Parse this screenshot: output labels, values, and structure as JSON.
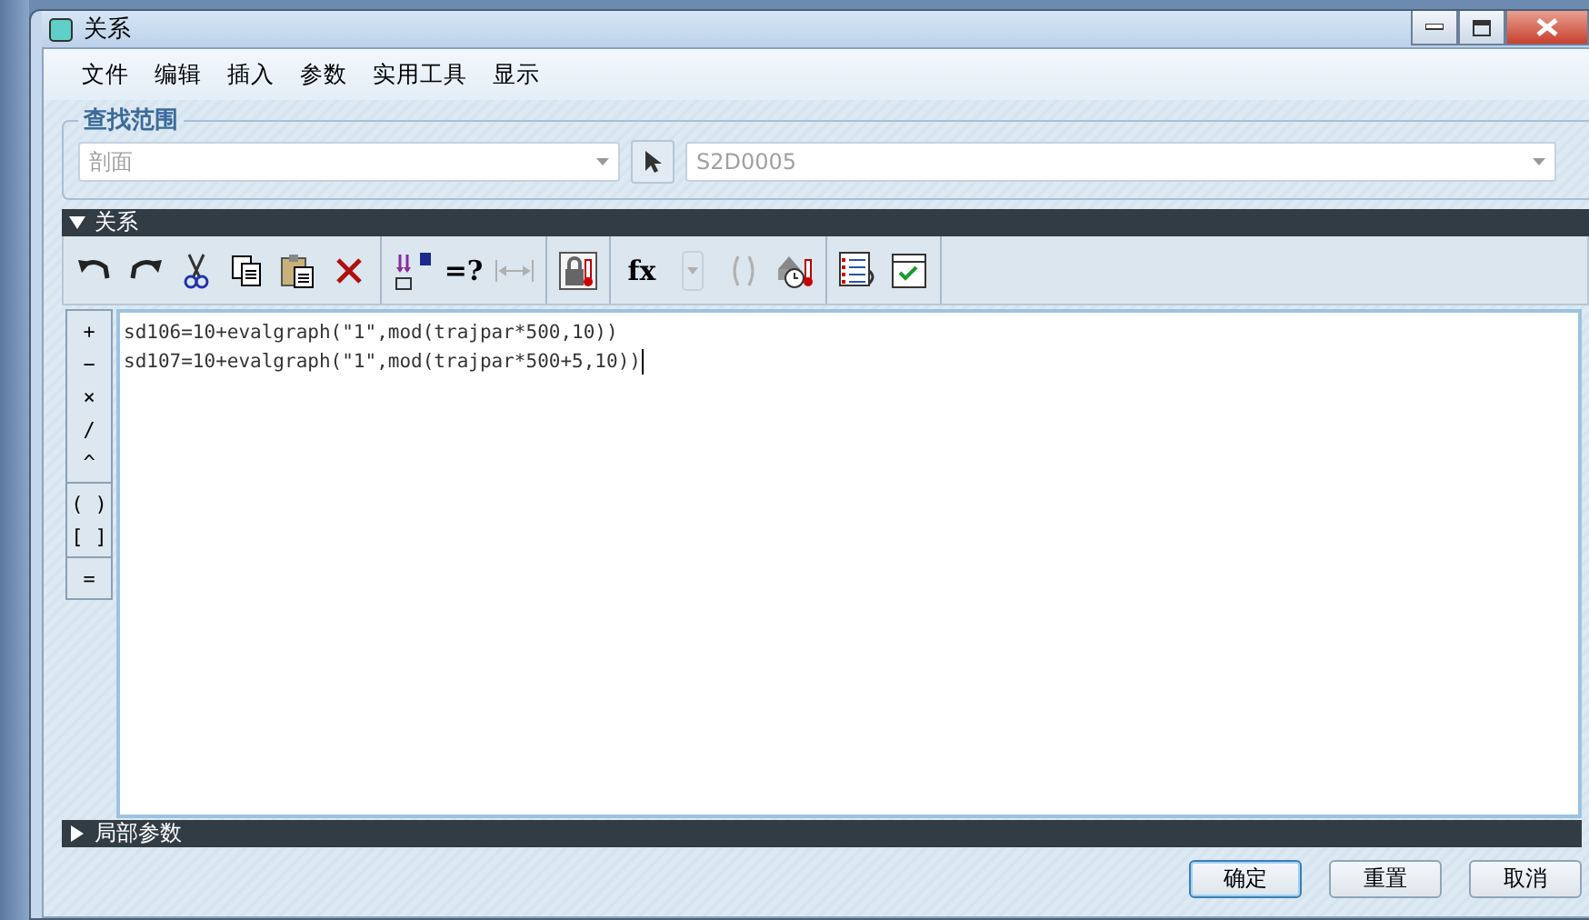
{
  "window": {
    "title": "关系"
  },
  "menu": [
    "文件",
    "编辑",
    "插入",
    "参数",
    "实用工具",
    "显示"
  ],
  "search_scope": {
    "legend": "查找范围",
    "type_value": "剖面",
    "object_value": "S2D0005"
  },
  "relations_section": {
    "title": "关系",
    "expanded": true
  },
  "toolbar": [
    [
      {
        "kind": "undo",
        "disabled": false
      },
      {
        "kind": "redo",
        "disabled": false
      },
      {
        "kind": "cut",
        "disabled": false
      },
      {
        "kind": "copy",
        "disabled": false
      },
      {
        "kind": "paste",
        "disabled": false
      },
      {
        "kind": "delete",
        "disabled": false
      }
    ],
    [
      {
        "kind": "sort",
        "disabled": false
      },
      {
        "kind": "text",
        "label": "=?",
        "disabled": false
      },
      {
        "kind": "dimension",
        "disabled": true
      }
    ],
    [
      {
        "kind": "lock-thermo",
        "disabled": false
      }
    ],
    [
      {
        "kind": "text",
        "label": "fx",
        "disabled": false
      },
      {
        "kind": "dropdown",
        "disabled": true
      },
      {
        "kind": "brackets",
        "disabled": true
      },
      {
        "kind": "clock-thermo",
        "disabled": false
      }
    ],
    [
      {
        "kind": "list",
        "disabled": false
      },
      {
        "kind": "checklist",
        "disabled": false
      }
    ]
  ],
  "operators": [
    [
      "+",
      "−",
      "×",
      "/",
      "^"
    ],
    [
      "( )",
      "[ ]"
    ],
    [
      "="
    ]
  ],
  "editor_lines": [
    "sd106=10+evalgraph(\"1\",mod(trajpar*500,10))",
    "sd107=10+evalgraph(\"1\",mod(trajpar*500+5,10))"
  ],
  "local_params_section": {
    "title": "局部参数",
    "expanded": false
  },
  "buttons": [
    {
      "label": "确定",
      "default": true
    },
    {
      "label": "重置",
      "default": false
    },
    {
      "label": "取消",
      "default": false
    }
  ]
}
